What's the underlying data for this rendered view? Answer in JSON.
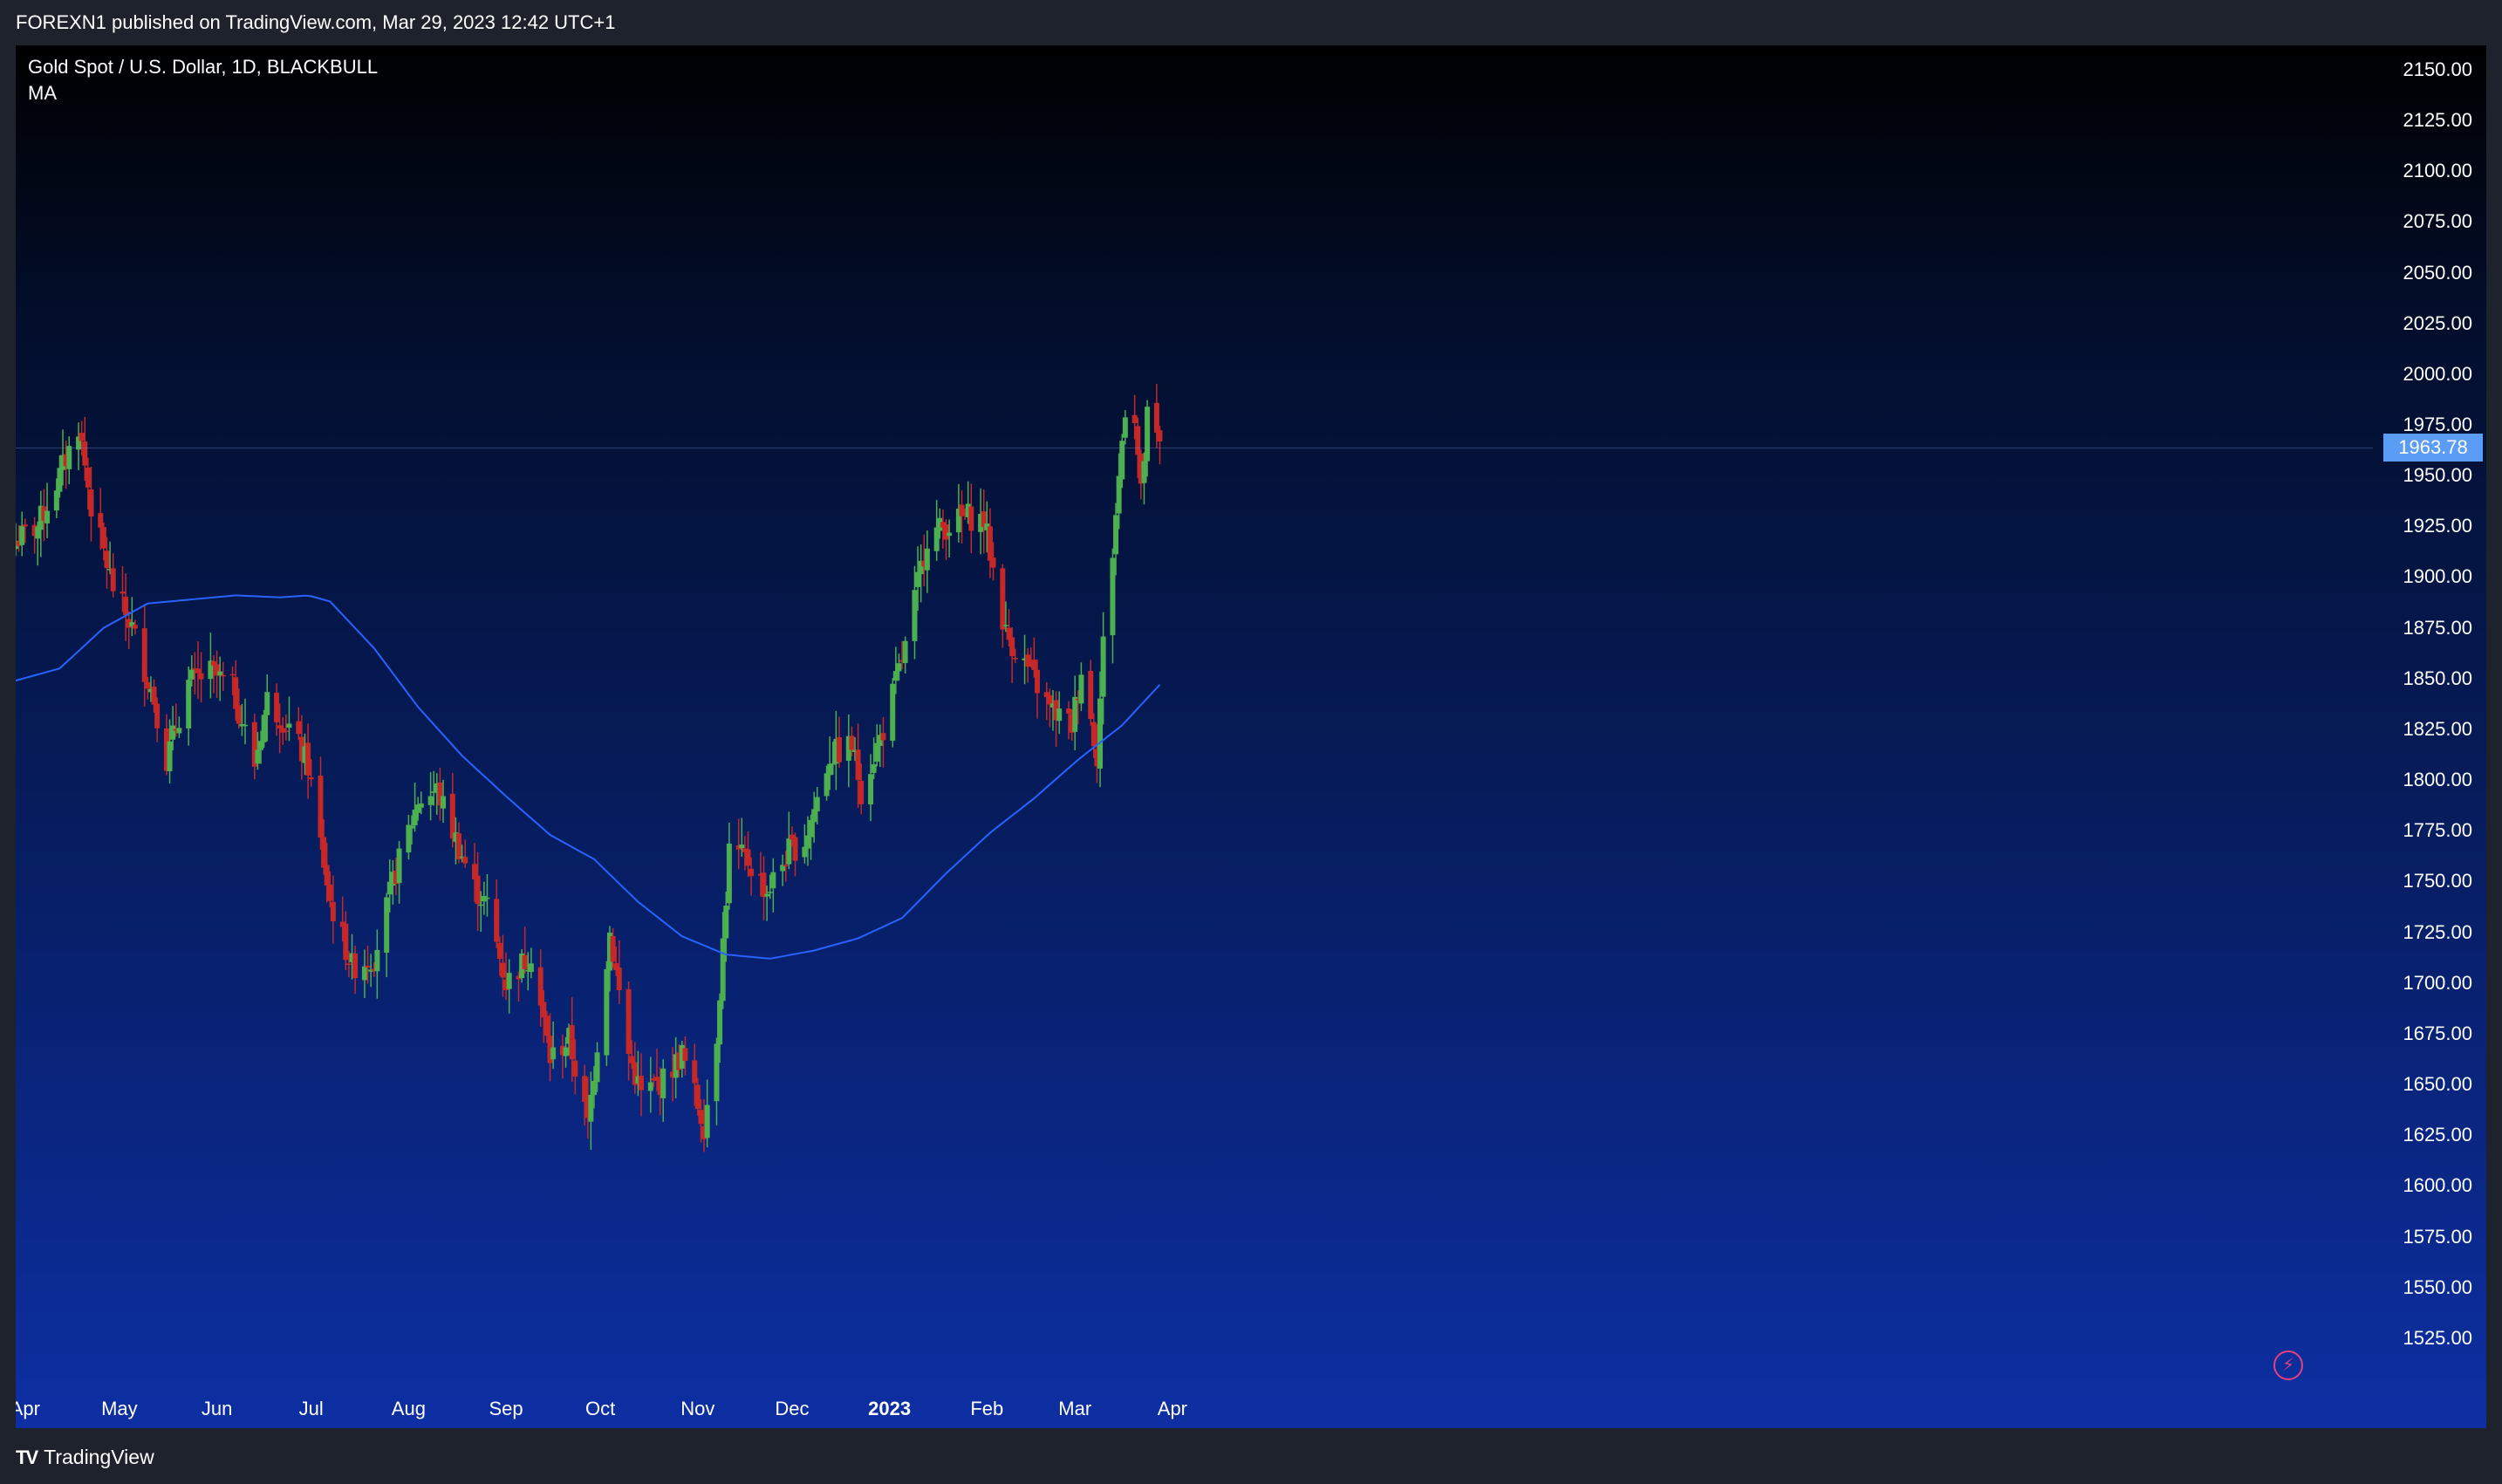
{
  "header": {
    "published": "FOREXN1 published on TradingView.com, Mar 29, 2023 12:42 UTC+1"
  },
  "legend": {
    "title": "Gold Spot / U.S. Dollar, 1D, BLACKBULL",
    "ma": "MA"
  },
  "footer": {
    "brand": "TradingView",
    "logo_icon": "tradingview-logo-icon"
  },
  "colors": {
    "up": "#4caf50",
    "down": "#c62828",
    "ma": "#2962ff",
    "badge": "#5b9cf6"
  },
  "chart_data": {
    "type": "candlestick",
    "title": "Gold Spot / U.S. Dollar, 1D, BLACKBULL",
    "ylim": [
      1500,
      2162
    ],
    "y_ticks": [
      "2150.00",
      "2125.00",
      "2100.00",
      "2075.00",
      "2050.00",
      "2025.00",
      "2000.00",
      "1975.00",
      "1950.00",
      "1925.00",
      "1900.00",
      "1875.00",
      "1850.00",
      "1825.00",
      "1800.00",
      "1775.00",
      "1750.00",
      "1725.00",
      "1700.00",
      "1675.00",
      "1650.00",
      "1625.00",
      "1600.00",
      "1575.00",
      "1550.00",
      "1525.00"
    ],
    "x_ticks": [
      {
        "label": "Apr",
        "bold": false
      },
      {
        "label": "May",
        "bold": false
      },
      {
        "label": "Jun",
        "bold": false
      },
      {
        "label": "Jul",
        "bold": false
      },
      {
        "label": "Aug",
        "bold": false
      },
      {
        "label": "Sep",
        "bold": false
      },
      {
        "label": "Oct",
        "bold": false
      },
      {
        "label": "Nov",
        "bold": false
      },
      {
        "label": "Dec",
        "bold": false
      },
      {
        "label": "2023",
        "bold": true
      },
      {
        "label": "Feb",
        "bold": false
      },
      {
        "label": "Mar",
        "bold": false
      },
      {
        "label": "Apr",
        "bold": false
      }
    ],
    "last_price": "1963.78",
    "close_anchors": [
      [
        "2022-03-29",
        1918
      ],
      [
        "2022-04-05",
        1925
      ],
      [
        "2022-04-12",
        1950
      ],
      [
        "2022-04-18",
        1975
      ],
      [
        "2022-04-22",
        1935
      ],
      [
        "2022-04-29",
        1895
      ],
      [
        "2022-05-05",
        1875
      ],
      [
        "2022-05-12",
        1840
      ],
      [
        "2022-05-16",
        1810
      ],
      [
        "2022-05-23",
        1848
      ],
      [
        "2022-05-30",
        1853
      ],
      [
        "2022-06-06",
        1845
      ],
      [
        "2022-06-13",
        1808
      ],
      [
        "2022-06-17",
        1840
      ],
      [
        "2022-06-24",
        1826
      ],
      [
        "2022-06-30",
        1807
      ],
      [
        "2022-07-07",
        1740
      ],
      [
        "2022-07-14",
        1708
      ],
      [
        "2022-07-21",
        1713
      ],
      [
        "2022-07-28",
        1755
      ],
      [
        "2022-08-04",
        1790
      ],
      [
        "2022-08-10",
        1795
      ],
      [
        "2022-08-15",
        1775
      ],
      [
        "2022-08-22",
        1747
      ],
      [
        "2022-08-26",
        1738
      ],
      [
        "2022-09-01",
        1700
      ],
      [
        "2022-09-09",
        1715
      ],
      [
        "2022-09-15",
        1663
      ],
      [
        "2022-09-21",
        1672
      ],
      [
        "2022-09-27",
        1630
      ],
      [
        "2022-10-04",
        1725
      ],
      [
        "2022-10-10",
        1665
      ],
      [
        "2022-10-14",
        1645
      ],
      [
        "2022-10-21",
        1652
      ],
      [
        "2022-10-27",
        1665
      ],
      [
        "2022-11-03",
        1630
      ],
      [
        "2022-11-07",
        1675
      ],
      [
        "2022-11-11",
        1765
      ],
      [
        "2022-11-17",
        1760
      ],
      [
        "2022-11-23",
        1745
      ],
      [
        "2022-11-30",
        1765
      ],
      [
        "2022-12-05",
        1770
      ],
      [
        "2022-12-13",
        1812
      ],
      [
        "2022-12-20",
        1817
      ],
      [
        "2022-12-23",
        1795
      ],
      [
        "2022-12-30",
        1825
      ],
      [
        "2023-01-06",
        1865
      ],
      [
        "2023-01-13",
        1920
      ],
      [
        "2023-01-20",
        1926
      ],
      [
        "2023-01-26",
        1930
      ],
      [
        "2023-01-31",
        1928
      ],
      [
        "2023-02-02",
        1912
      ],
      [
        "2023-02-07",
        1872
      ],
      [
        "2023-02-14",
        1855
      ],
      [
        "2023-02-21",
        1835
      ],
      [
        "2023-02-28",
        1827
      ],
      [
        "2023-03-03",
        1855
      ],
      [
        "2023-03-08",
        1813
      ],
      [
        "2023-03-10",
        1867
      ],
      [
        "2023-03-13",
        1913
      ],
      [
        "2023-03-17",
        1985
      ],
      [
        "2023-03-20",
        1980
      ],
      [
        "2023-03-22",
        1940
      ],
      [
        "2023-03-24",
        1978
      ],
      [
        "2023-03-28",
        1963.78
      ]
    ],
    "ma_anchors": [
      [
        "2022-03-29",
        1849
      ],
      [
        "2022-04-12",
        1855
      ],
      [
        "2022-04-26",
        1875
      ],
      [
        "2022-05-10",
        1887
      ],
      [
        "2022-05-24",
        1889
      ],
      [
        "2022-06-07",
        1891
      ],
      [
        "2022-06-21",
        1890
      ],
      [
        "2022-06-30",
        1891
      ],
      [
        "2022-07-07",
        1888
      ],
      [
        "2022-07-21",
        1865
      ],
      [
        "2022-08-04",
        1836
      ],
      [
        "2022-08-18",
        1812
      ],
      [
        "2022-09-01",
        1792
      ],
      [
        "2022-09-15",
        1773
      ],
      [
        "2022-09-29",
        1761
      ],
      [
        "2022-10-13",
        1740
      ],
      [
        "2022-10-27",
        1723
      ],
      [
        "2022-11-10",
        1714
      ],
      [
        "2022-11-24",
        1712
      ],
      [
        "2022-12-08",
        1716
      ],
      [
        "2022-12-22",
        1722
      ],
      [
        "2023-01-05",
        1732
      ],
      [
        "2023-01-19",
        1754
      ],
      [
        "2023-02-02",
        1774
      ],
      [
        "2023-02-16",
        1791
      ],
      [
        "2023-03-02",
        1810
      ],
      [
        "2023-03-16",
        1827
      ],
      [
        "2023-03-28",
        1847
      ]
    ]
  }
}
